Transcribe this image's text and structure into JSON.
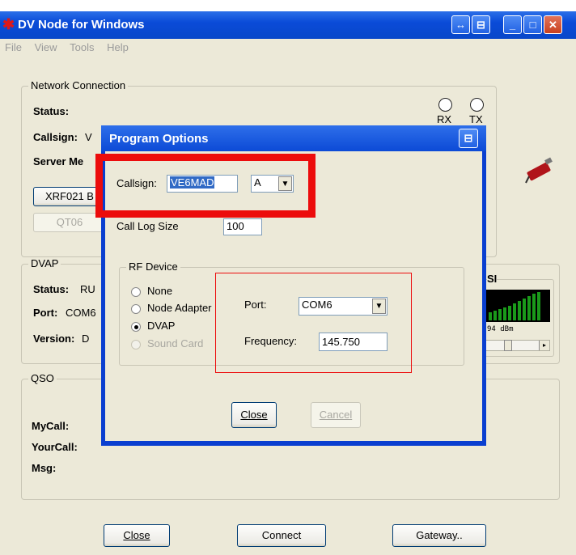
{
  "window": {
    "title": "DV Node for Windows"
  },
  "menu": [
    "File",
    "View",
    "Tools",
    "Help"
  ],
  "network": {
    "legend": "Network Connection",
    "status_label": "Status:",
    "callsign_label": "Callsign:",
    "callsign_value_partial": "V",
    "server_label_partial": "Server Me",
    "rx_label": "RX",
    "tx_label": "TX",
    "reflector_button": "XRF021 B",
    "qt_button": "QT06"
  },
  "dvap": {
    "legend": "DVAP",
    "status_label": "Status:",
    "status_value_partial": "RU",
    "port_label": "Port:",
    "port_value_partial": "COM6",
    "version_label": "Version:",
    "version_value_partial": "D",
    "rssi_legend_partial": "SI",
    "rssi_readout": "94 dBm"
  },
  "qso": {
    "legend": "QSO",
    "mycall_label": "MyCall:",
    "yourcall_label": "YourCall:",
    "msg_label": "Msg:"
  },
  "main_buttons": {
    "close": "Close",
    "connect": "Connect",
    "gateway": "Gateway.."
  },
  "dialog": {
    "title": "Program Options",
    "callsign_label": "Callsign:",
    "callsign_value": "VE6MAD",
    "suffix_value": "A",
    "calllog_label": "Call Log Size",
    "calllog_value": "100",
    "rf_legend": "RF Device",
    "rf_options": [
      "None",
      "Node Adapter",
      "DVAP",
      "Sound Card"
    ],
    "rf_selected": "DVAP",
    "port_label": "Port:",
    "port_value": "COM6",
    "frequency_label": "Frequency:",
    "frequency_value": "145.750",
    "close_button": "Close",
    "cancel_button": "Cancel"
  },
  "colors": {
    "titlebar": "#0a4bd8",
    "highlight_box": "#ec0c0c",
    "signal_green": "#1a9a1a"
  }
}
